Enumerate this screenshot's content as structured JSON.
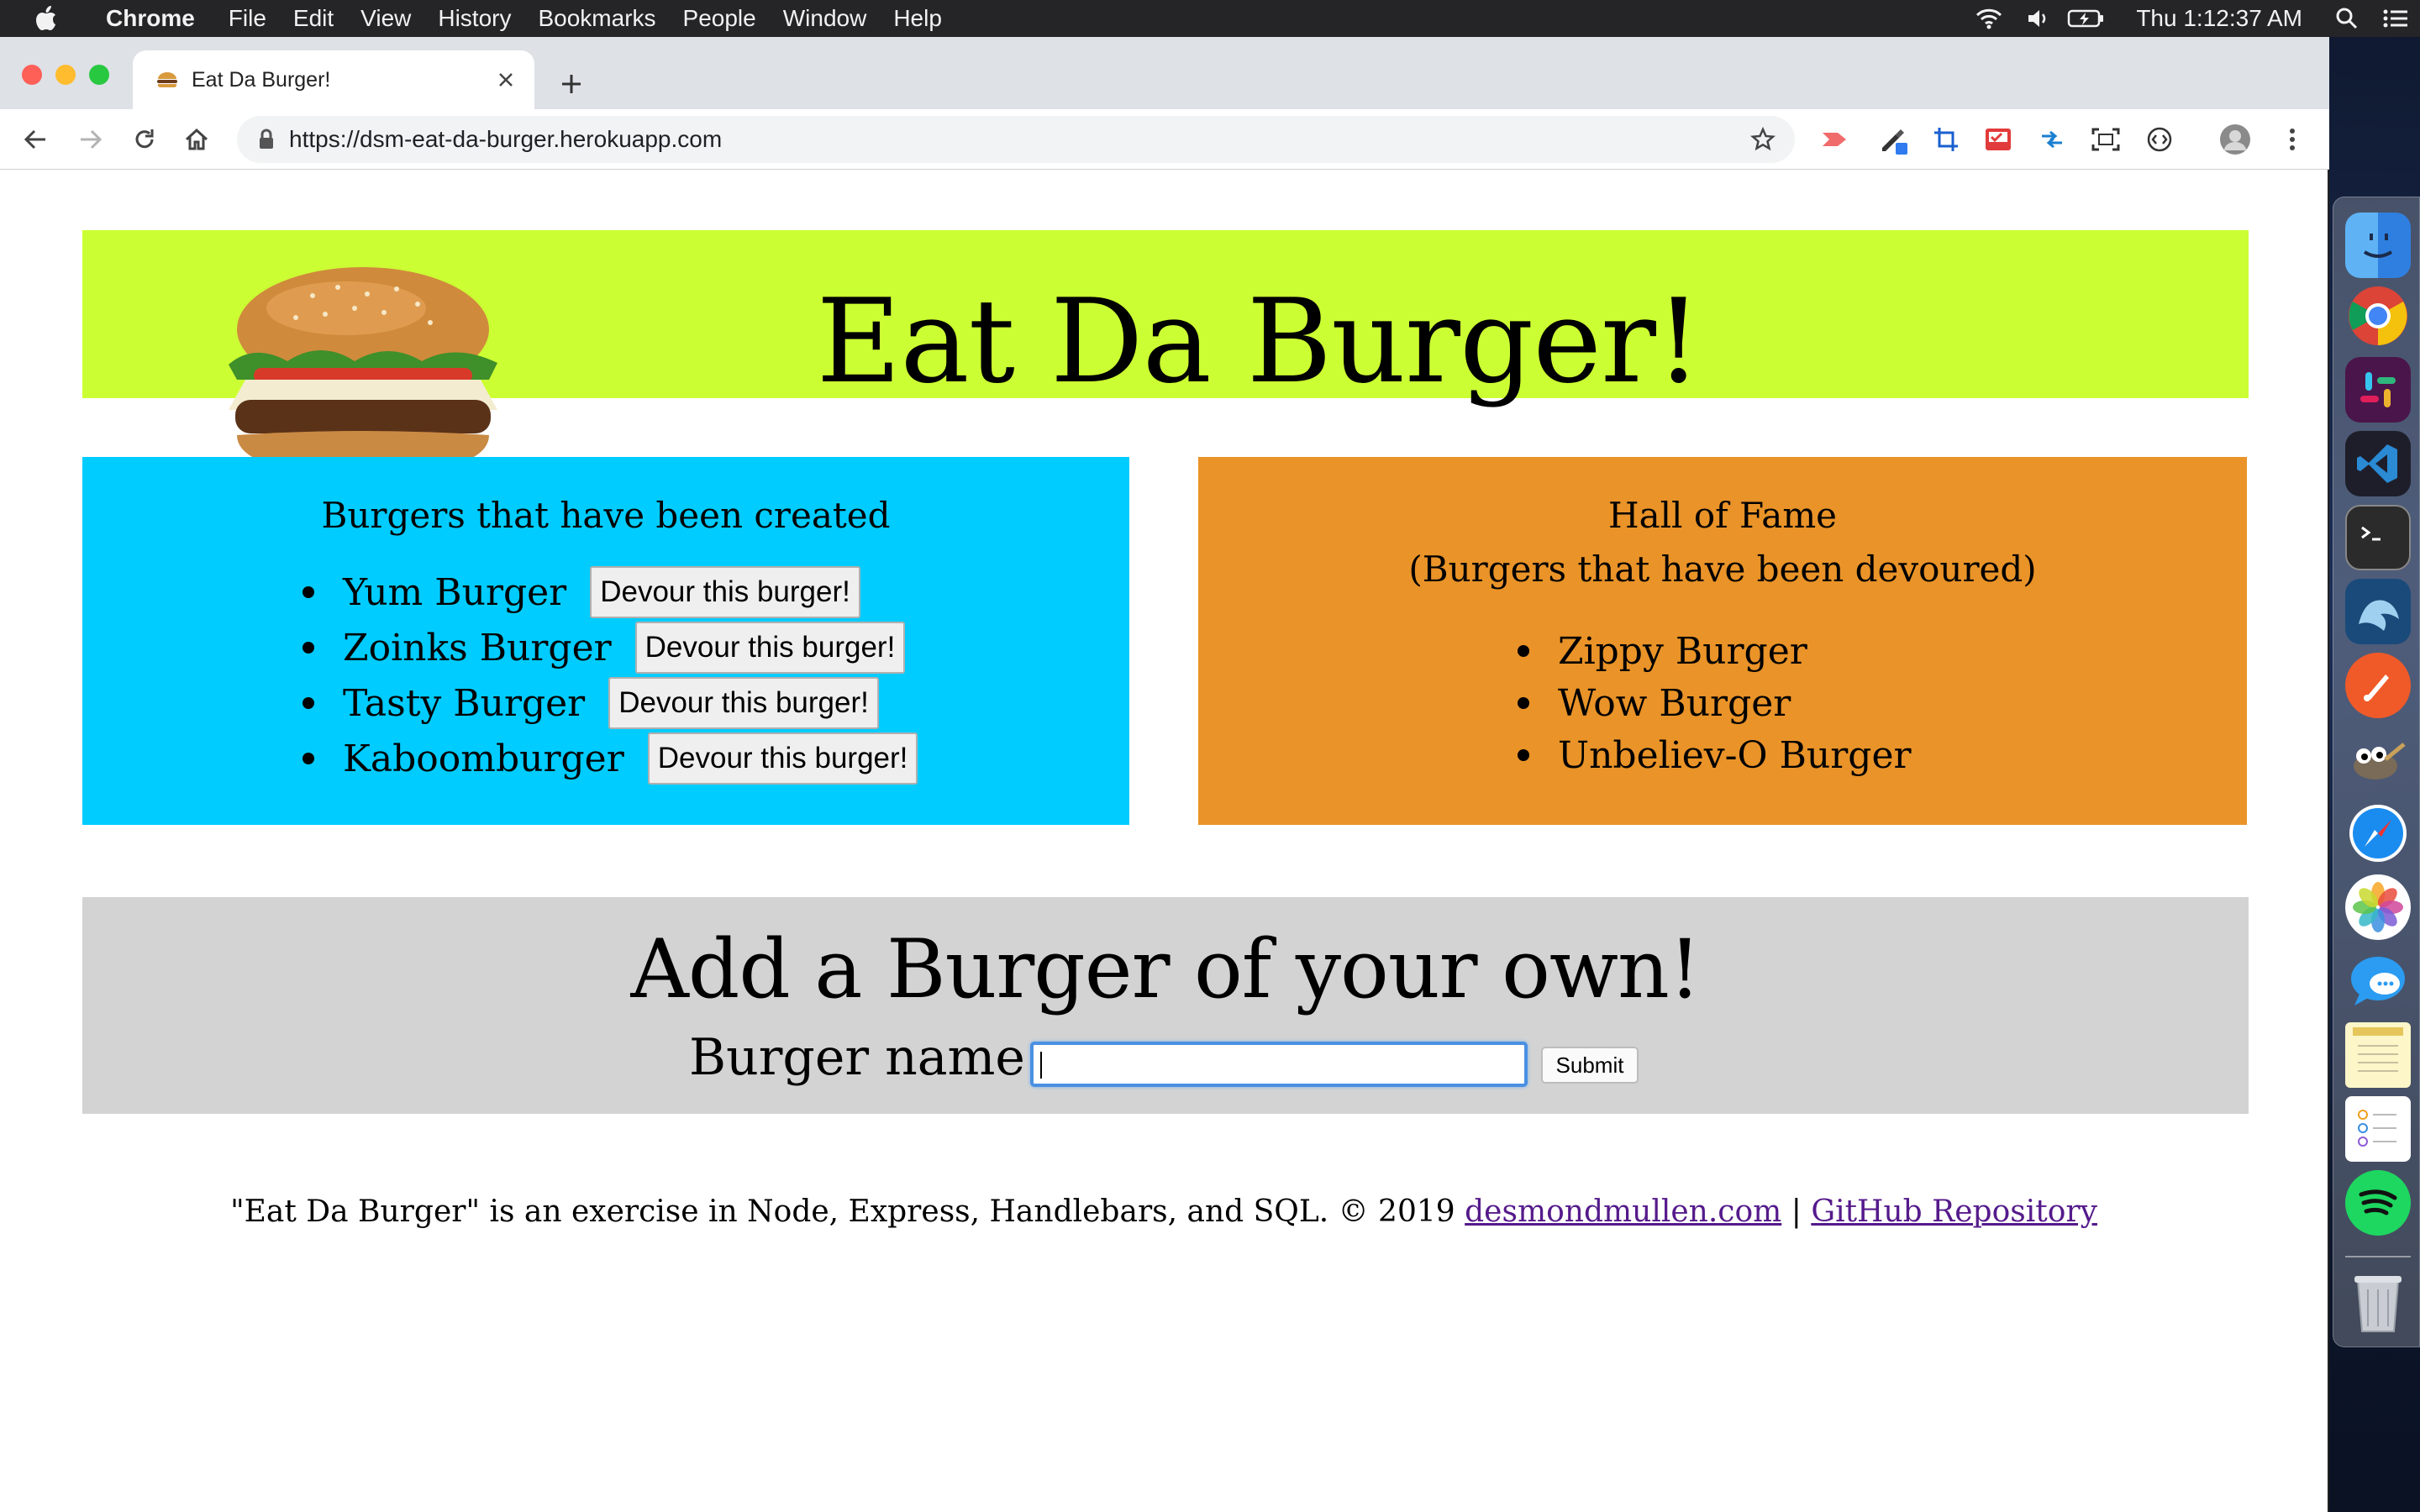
{
  "menubar": {
    "app_name": "Chrome",
    "items": [
      "File",
      "Edit",
      "View",
      "History",
      "Bookmarks",
      "People",
      "Window",
      "Help"
    ],
    "clock": "Thu 1:12:37 AM",
    "status_icons": [
      "wifi-icon",
      "volume-icon",
      "battery-charging-icon",
      "search-icon",
      "list-icon"
    ]
  },
  "browser": {
    "tab_title": "Eat Da Burger!",
    "url": "https://dsm-eat-da-burger.herokuapp.com",
    "extensions": [
      "red-arrow-extension-icon",
      "color-picker-extension-icon",
      "crop-extension-icon",
      "selenium-extension-icon",
      "arrows-extension-icon",
      "screenshot-extension-icon",
      "code-extension-icon",
      "profile-avatar-icon",
      "more-menu-icon"
    ]
  },
  "page": {
    "title": "Eat Da Burger!",
    "created": {
      "heading": "Burgers that have been created",
      "button_label": "Devour this burger!",
      "burgers": [
        "Yum Burger",
        "Zoinks Burger",
        "Tasty Burger",
        "Kaboomburger"
      ]
    },
    "devoured": {
      "heading_line1": "Hall of Fame",
      "heading_line2": "(Burgers that have been devoured)",
      "burgers": [
        "Zippy Burger",
        "Wow Burger",
        "Unbeliev-O Burger"
      ]
    },
    "form": {
      "title": "Add a Burger of your own!",
      "label": "Burger name:",
      "input_value": "",
      "submit_label": "Submit"
    },
    "footer": {
      "text": "\"Eat Da Burger\" is an exercise in Node, Express, Handlebars, and SQL. © 2019",
      "link1": "desmondmullen.com",
      "separator": "|",
      "link2": "GitHub Repository"
    }
  },
  "dock": {
    "apps": [
      "finder-icon",
      "chrome-icon",
      "slack-icon",
      "vscode-icon",
      "terminal-icon",
      "mysql-workbench-icon",
      "paw-icon",
      "gimp-icon",
      "safari-icon",
      "photos-icon",
      "messages-icon",
      "notes-icon",
      "reminders-icon",
      "spotify-icon",
      "trash-icon"
    ]
  },
  "colors": {
    "jumbotron": "#ccff33",
    "created_panel": "#00ccff",
    "devoured_panel": "#e99328",
    "form_panel": "#d3d3d3",
    "link": "#551a8b"
  }
}
